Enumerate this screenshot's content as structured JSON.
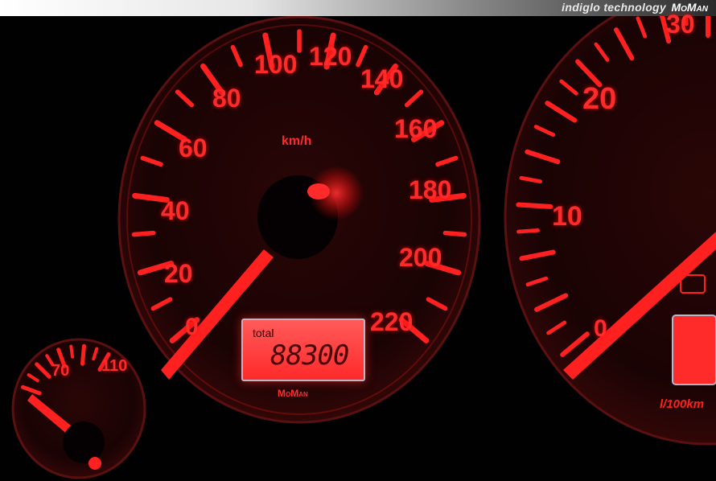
{
  "banner": {
    "text": "indiglo technology",
    "brand": "MoMan"
  },
  "speedometer": {
    "unit": "km/h",
    "scale_labels": [
      "0",
      "20",
      "40",
      "60",
      "80",
      "100",
      "120",
      "140",
      "160",
      "180",
      "200",
      "220"
    ],
    "brand": "MoMan"
  },
  "odometer": {
    "label": "total",
    "value": "88300"
  },
  "consumption_gauge": {
    "scale_labels": [
      "0",
      "10",
      "20",
      "30"
    ],
    "unit": "l/100km"
  },
  "small_gauge": {
    "scale_labels": [
      "70",
      "110"
    ]
  },
  "colors": {
    "glow": "#ff2020",
    "background": "#020102",
    "dial": "#1a0405"
  }
}
